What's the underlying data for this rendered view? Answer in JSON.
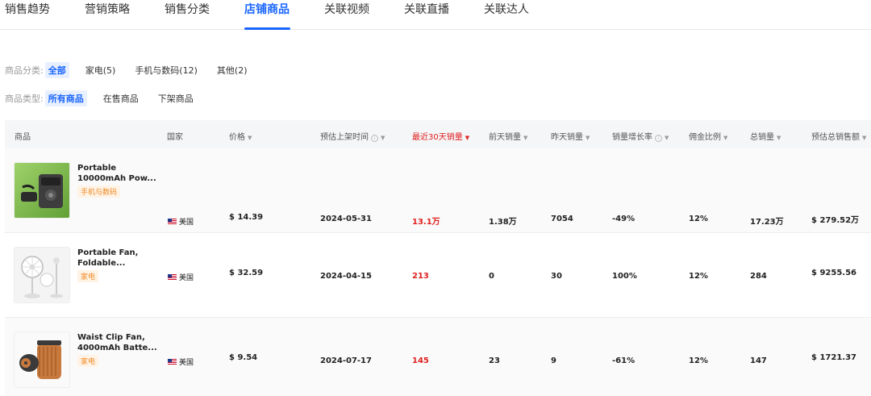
{
  "tabs": [
    {
      "label": "销售趋势"
    },
    {
      "label": "营销策略"
    },
    {
      "label": "销售分类"
    },
    {
      "label": "店铺商品"
    },
    {
      "label": "关联视频"
    },
    {
      "label": "关联直播"
    },
    {
      "label": "关联达人"
    }
  ],
  "filters": {
    "category": {
      "label": "商品分类:",
      "options": [
        {
          "label": "全部"
        },
        {
          "label": "家电(5)"
        },
        {
          "label": "手机与数码(12)"
        },
        {
          "label": "其他(2)"
        }
      ],
      "selected": "全部"
    },
    "type": {
      "label": "商品类型:",
      "options": [
        {
          "label": "所有商品"
        },
        {
          "label": "在售商品"
        },
        {
          "label": "下架商品"
        }
      ],
      "selected": "所有商品"
    }
  },
  "table": {
    "columns": [
      {
        "label": "商品"
      },
      {
        "label": "国家"
      },
      {
        "label": "价格"
      },
      {
        "label": "预估上架时间"
      },
      {
        "label": "最近30天销量"
      },
      {
        "label": "前天销量"
      },
      {
        "label": "昨天销量"
      },
      {
        "label": "销量增长率"
      },
      {
        "label": "佣金比例"
      },
      {
        "label": "总销量"
      },
      {
        "label": "预估总销售额"
      }
    ],
    "sorted_by": "最近30天销量",
    "sort_direction": "desc",
    "rows": [
      {
        "name_line1": "Portable",
        "name_line2": "10000mAh Pow...",
        "tag": "手机与数码",
        "country": "美国",
        "price": "$ 14.39",
        "list_date": "2024-05-31",
        "sales_30d": "13.1万",
        "sales_day_before": "1.38万",
        "sales_yesterday": "7054",
        "growth": "-49%",
        "commission": "12%",
        "total_sales": "17.23万",
        "total_revenue": "$ 279.52万"
      },
      {
        "name_line1": "Portable Fan,",
        "name_line2": "Foldable...",
        "tag": "家电",
        "country": "美国",
        "price": "$ 32.59",
        "list_date": "2024-04-15",
        "sales_30d": "213",
        "sales_day_before": "0",
        "sales_yesterday": "30",
        "growth": "100%",
        "commission": "12%",
        "total_sales": "284",
        "total_revenue": "$ 9255.56"
      },
      {
        "name_line1": "Waist Clip Fan,",
        "name_line2": "4000mAh Batte...",
        "tag": "家电",
        "country": "美国",
        "price": "$ 9.54",
        "list_date": "2024-07-17",
        "sales_30d": "145",
        "sales_day_before": "23",
        "sales_yesterday": "9",
        "growth": "-61%",
        "commission": "12%",
        "total_sales": "147",
        "total_revenue": "$ 1721.37"
      }
    ]
  },
  "colors": {
    "accent": "#1a66ff",
    "highlight": "#e02020",
    "tag_text": "#f08a24",
    "tag_bg": "#fff3e6"
  }
}
